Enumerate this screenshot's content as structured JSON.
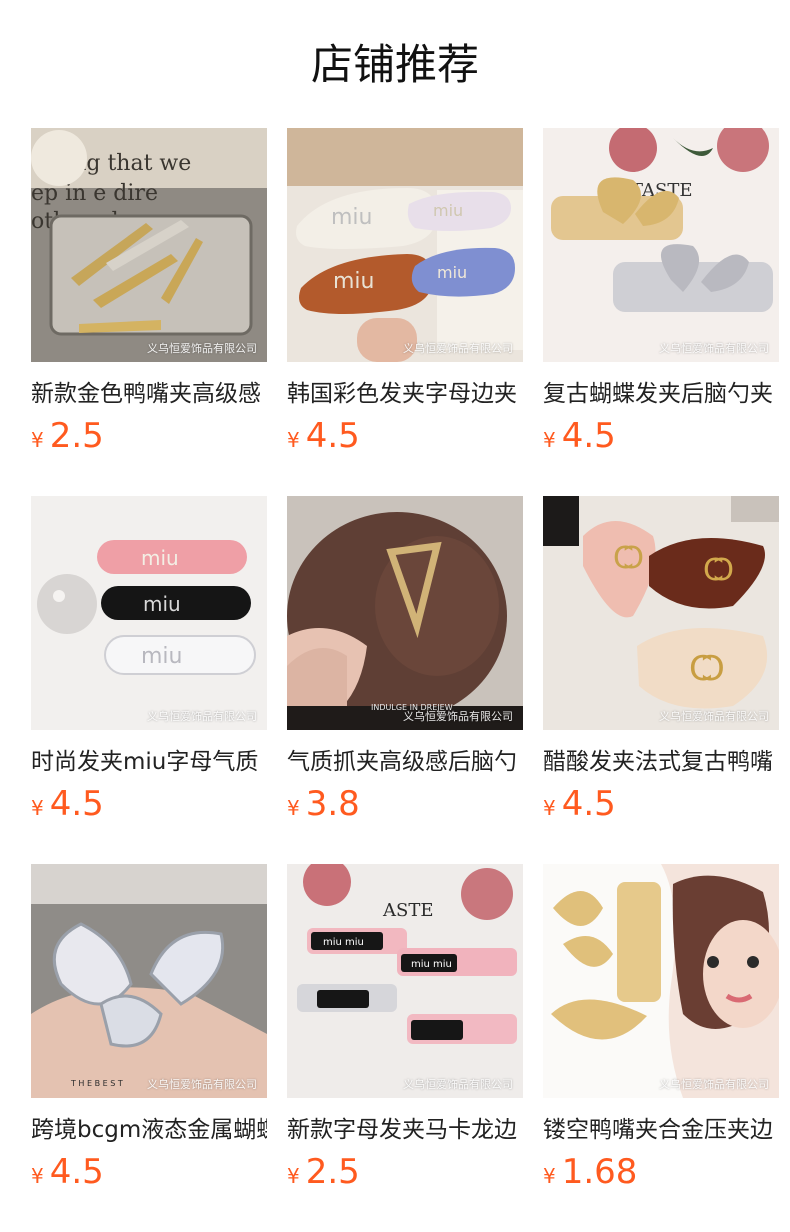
{
  "header": {
    "title": "店铺推荐"
  },
  "colors": {
    "price": "#ff5a1f",
    "text": "#222222"
  },
  "products": [
    {
      "name": "新款金色鸭嘴夹高级感",
      "currency": "¥",
      "price": "2.5",
      "watermark": "义乌恒爱饰品有限公司",
      "image_icon": "gold-duckbill-clips-photo"
    },
    {
      "name": "韩国彩色发夹字母边夹",
      "currency": "¥",
      "price": "4.5",
      "watermark": "义乌恒爱饰品有限公司",
      "image_icon": "colorful-letter-clips-photo"
    },
    {
      "name": "复古蝴蝶发夹后脑勺夹",
      "currency": "¥",
      "price": "4.5",
      "watermark": "义乌恒爱饰品有限公司",
      "image_icon": "butterfly-clips-photo"
    },
    {
      "name": "时尚发夹miu字母气质",
      "currency": "¥",
      "price": "4.5",
      "watermark": "义乌恒爱饰品有限公司",
      "image_icon": "miu-letter-clips-photo"
    },
    {
      "name": "气质抓夹高级感后脑勺",
      "currency": "¥",
      "price": "3.8",
      "watermark": "义乌恒爱饰品有限公司",
      "image_icon": "triangle-claw-clip-photo"
    },
    {
      "name": "醋酸发夹法式复古鸭嘴",
      "currency": "¥",
      "price": "4.5",
      "watermark": "义乌恒爱饰品有限公司",
      "image_icon": "acetate-clips-photo"
    },
    {
      "name": "跨境bcgm液态金属蝴蝶",
      "currency": "¥",
      "price": "4.5",
      "watermark": "义乌恒爱饰品有限公司",
      "image_icon": "liquid-metal-butterfly-photo"
    },
    {
      "name": "新款字母发夹马卡龙边",
      "currency": "¥",
      "price": "2.5",
      "watermark": "义乌恒爱饰品有限公司",
      "image_icon": "macaron-letter-clips-photo"
    },
    {
      "name": "镂空鸭嘴夹合金压夹边",
      "currency": "¥",
      "price": "1.68",
      "watermark": "义乌恒爱饰品有限公司",
      "image_icon": "hollow-alloy-clips-photo"
    }
  ]
}
